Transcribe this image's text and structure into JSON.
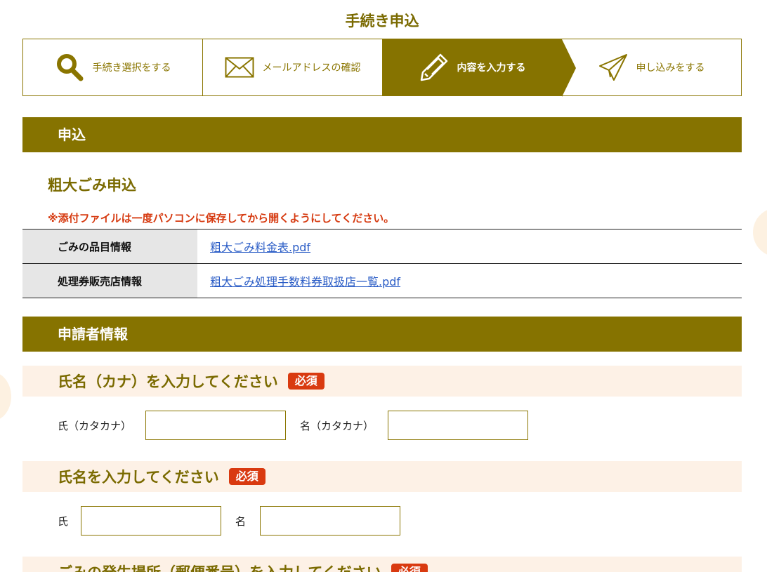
{
  "page_title": "手続き申込",
  "steps": [
    {
      "label": "手続き選択をする",
      "icon": "search-icon"
    },
    {
      "label": "メールアドレスの確認",
      "icon": "mail-icon"
    },
    {
      "label": "内容を入力する",
      "icon": "pencil-icon",
      "active": true
    },
    {
      "label": "申し込みをする",
      "icon": "send-icon"
    }
  ],
  "sections": {
    "apply": "申込",
    "applicant": "申請者情報"
  },
  "sub_title": "粗大ごみ申込",
  "notice": "※添付ファイルは一度パソコンに保存してから開くようにしてください。",
  "info_rows": [
    {
      "label": "ごみの品目情報",
      "link": "粗大ごみ料金表.pdf"
    },
    {
      "label": "処理券販売店情報",
      "link": "粗大ごみ処理手数料券取扱店一覧.pdf"
    }
  ],
  "questions": {
    "kana": {
      "title": "氏名（カナ）を入力してください",
      "required": "必須",
      "last_label": "氏（カタカナ）",
      "first_label": "名（カタカナ）",
      "last_value": "",
      "first_value": ""
    },
    "name": {
      "title": "氏名を入力してください",
      "required": "必須",
      "last_label": "氏",
      "first_label": "名",
      "last_value": "",
      "first_value": ""
    },
    "postal": {
      "title": "ごみの発生場所（郵便番号）を入力してください",
      "required": "必須"
    }
  },
  "colors": {
    "brand": "#867300",
    "required": "#d93a10",
    "question_bg": "#fdf1e6",
    "link": "#2a5cc6"
  }
}
